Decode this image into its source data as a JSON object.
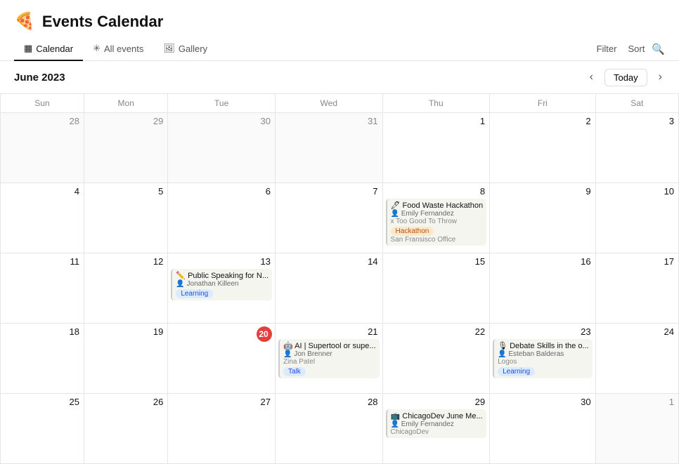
{
  "app": {
    "icon": "🍕",
    "title": "Events Calendar"
  },
  "nav": {
    "tabs": [
      {
        "id": "calendar",
        "icon": "▦",
        "label": "Calendar",
        "active": true
      },
      {
        "id": "all-events",
        "icon": "✳",
        "label": "All events",
        "active": false
      },
      {
        "id": "gallery",
        "icon": "🖼",
        "label": "Gallery",
        "active": false
      }
    ]
  },
  "toolbar": {
    "month_label": "June 2023",
    "filter_label": "Filter",
    "sort_label": "Sort",
    "today_label": "Today"
  },
  "calendar": {
    "weekdays": [
      "Sun",
      "Mon",
      "Tue",
      "Wed",
      "Thu",
      "Fri",
      "Sat"
    ],
    "weeks": [
      {
        "days": [
          {
            "date": "28",
            "other": true,
            "events": []
          },
          {
            "date": "29",
            "other": true,
            "events": []
          },
          {
            "date": "30",
            "other": true,
            "events": []
          },
          {
            "date": "31",
            "other": true,
            "events": []
          },
          {
            "date": "1",
            "other": false,
            "events": []
          },
          {
            "date": "2",
            "other": false,
            "events": []
          },
          {
            "date": "3",
            "other": false,
            "events": []
          }
        ]
      },
      {
        "days": [
          {
            "date": "4",
            "other": false,
            "events": []
          },
          {
            "date": "5",
            "other": false,
            "events": []
          },
          {
            "date": "6",
            "other": false,
            "events": []
          },
          {
            "date": "7",
            "other": false,
            "events": []
          },
          {
            "date": "8",
            "other": false,
            "events": [
              {
                "icon": "🖊",
                "title": "Food Waste Hackathon",
                "host": "Emily Fernandez",
                "host_icon": "👤",
                "org": "x Too Good To Throw",
                "tag": "Hackathon",
                "tag_class": "tag-hackathon",
                "location": "San Fransisco Office"
              }
            ]
          },
          {
            "date": "9",
            "other": false,
            "events": []
          },
          {
            "date": "10",
            "other": false,
            "events": []
          }
        ]
      },
      {
        "days": [
          {
            "date": "11",
            "other": false,
            "events": []
          },
          {
            "date": "12",
            "other": false,
            "events": []
          },
          {
            "date": "13",
            "other": false,
            "events": [
              {
                "icon": "✏️",
                "title": "Public Speaking for N...",
                "host": "Jonathan Killeen",
                "host_icon": "👤",
                "org": "",
                "tag": "Learning",
                "tag_class": "tag-learning",
                "location": ""
              }
            ]
          },
          {
            "date": "14",
            "other": false,
            "events": []
          },
          {
            "date": "15",
            "other": false,
            "events": []
          },
          {
            "date": "16",
            "other": false,
            "events": []
          },
          {
            "date": "17",
            "other": false,
            "events": []
          }
        ]
      },
      {
        "days": [
          {
            "date": "18",
            "other": false,
            "events": []
          },
          {
            "date": "19",
            "other": false,
            "events": []
          },
          {
            "date": "20",
            "other": false,
            "today": true,
            "events": []
          },
          {
            "date": "21",
            "other": false,
            "events": [
              {
                "icon": "🤖",
                "title": "AI | Supertool or supe...",
                "host": "Jon Brenner",
                "host_icon": "👤",
                "org": "Zina Patel",
                "tag": "Talk",
                "tag_class": "tag-talk",
                "location": ""
              }
            ]
          },
          {
            "date": "22",
            "other": false,
            "events": []
          },
          {
            "date": "23",
            "other": false,
            "events": [
              {
                "icon": "🎙",
                "title": "Debate Skills in the o...",
                "host": "Esteban Balderas",
                "host_icon": "👤",
                "org": "Logos",
                "tag": "Learning",
                "tag_class": "tag-learning",
                "location": ""
              }
            ]
          },
          {
            "date": "24",
            "other": false,
            "events": []
          }
        ]
      },
      {
        "days": [
          {
            "date": "25",
            "other": false,
            "events": []
          },
          {
            "date": "26",
            "other": false,
            "events": []
          },
          {
            "date": "27",
            "other": false,
            "events": []
          },
          {
            "date": "28",
            "other": false,
            "events": []
          },
          {
            "date": "29",
            "other": false,
            "events": [
              {
                "icon": "📺",
                "title": "ChicagoDev June Me...",
                "host": "Emily Fernandez",
                "host_icon": "👤",
                "org": "ChicagoDev",
                "tag": "",
                "tag_class": "",
                "location": ""
              }
            ]
          },
          {
            "date": "30",
            "other": false,
            "events": []
          },
          {
            "date": "1",
            "other": true,
            "events": []
          }
        ]
      }
    ]
  }
}
